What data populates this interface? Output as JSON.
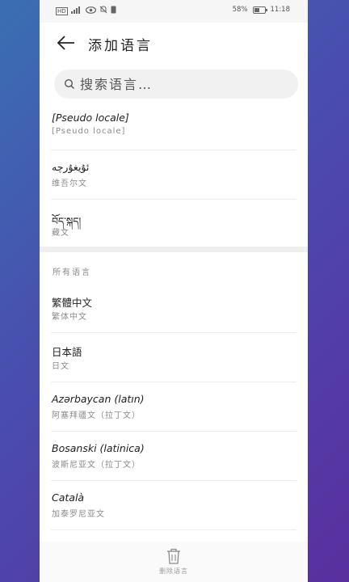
{
  "status_bar": {
    "left_icons": [
      "HD",
      "4G",
      "signal",
      "eye",
      "mute",
      "sim"
    ],
    "battery_text": "58%",
    "battery_level": 0.58,
    "time": "11:18"
  },
  "header": {
    "title": "添加语言",
    "back_icon": "arrow-left-icon"
  },
  "search": {
    "placeholder": "搜索语言…"
  },
  "suggested": [
    {
      "title": "[Pseudo locale]",
      "subtitle": "[Pseudo locale]"
    },
    {
      "title": "ئۇيغۇرچە",
      "subtitle": "维吾尔文"
    },
    {
      "title": "བོད་སྐད།",
      "subtitle": "藏文"
    }
  ],
  "all_languages_label": "所有语言",
  "all_languages": [
    {
      "title": "繁體中文",
      "subtitle": "繁体中文"
    },
    {
      "title": "日本語",
      "subtitle": "日文"
    },
    {
      "title": "Azərbaycan (latın)",
      "subtitle": "阿塞拜疆文（拉丁文）"
    },
    {
      "title": "Bosanski (latinica)",
      "subtitle": "波斯尼亚文（拉丁文）"
    },
    {
      "title": "Català",
      "subtitle": "加泰罗尼亚文"
    }
  ],
  "bottom": {
    "delete_label": "删除语言",
    "icon": "trash-icon"
  },
  "colors": {
    "background_start": "#3a6fb3",
    "background_end": "#5a2f9e",
    "panel": "#ffffff"
  }
}
